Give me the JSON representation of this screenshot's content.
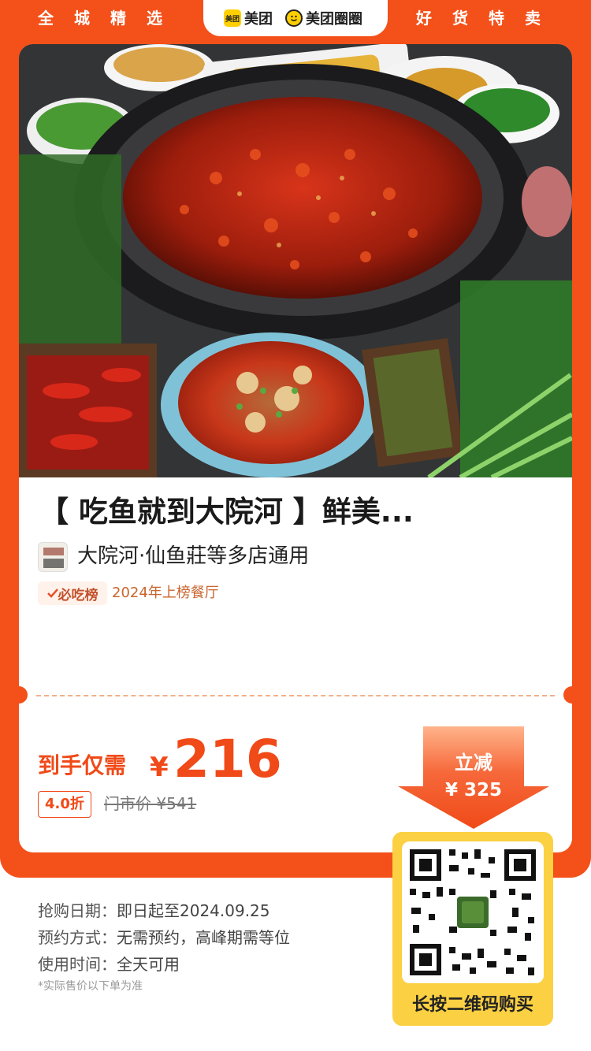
{
  "header": {
    "left_slogan": "全城精选",
    "right_slogan": "好货特卖",
    "brand1": "美团",
    "brand1_logo_text": "美团",
    "brand2": "美团圈圈"
  },
  "product": {
    "title": "【 吃鱼就到大院河 】鲜美...",
    "store_name": "大院河·仙鱼莊等多店通用",
    "rank_badge": "必吃榜",
    "rank_text": "2024年上榜餐厅"
  },
  "pricing": {
    "label": "到手仅需",
    "currency": "¥",
    "price": "216",
    "discount": "4.0折",
    "original_price": "门市价 ¥541",
    "save_label": "立减",
    "save_amount": "¥ 325"
  },
  "qr": {
    "label": "长按二维码购买"
  },
  "info": {
    "rows": [
      {
        "key": "抢购日期：",
        "value": "即日起至2024.09.25"
      },
      {
        "key": "预约方式：",
        "value": "无需预约，高峰期需等位"
      },
      {
        "key": "使用时间：",
        "value": "全天可用"
      }
    ],
    "note": "*实际售价以下单为准"
  },
  "colors": {
    "accent": "#f4501a",
    "price": "#f04a18",
    "qr_frame": "#fbd043"
  }
}
